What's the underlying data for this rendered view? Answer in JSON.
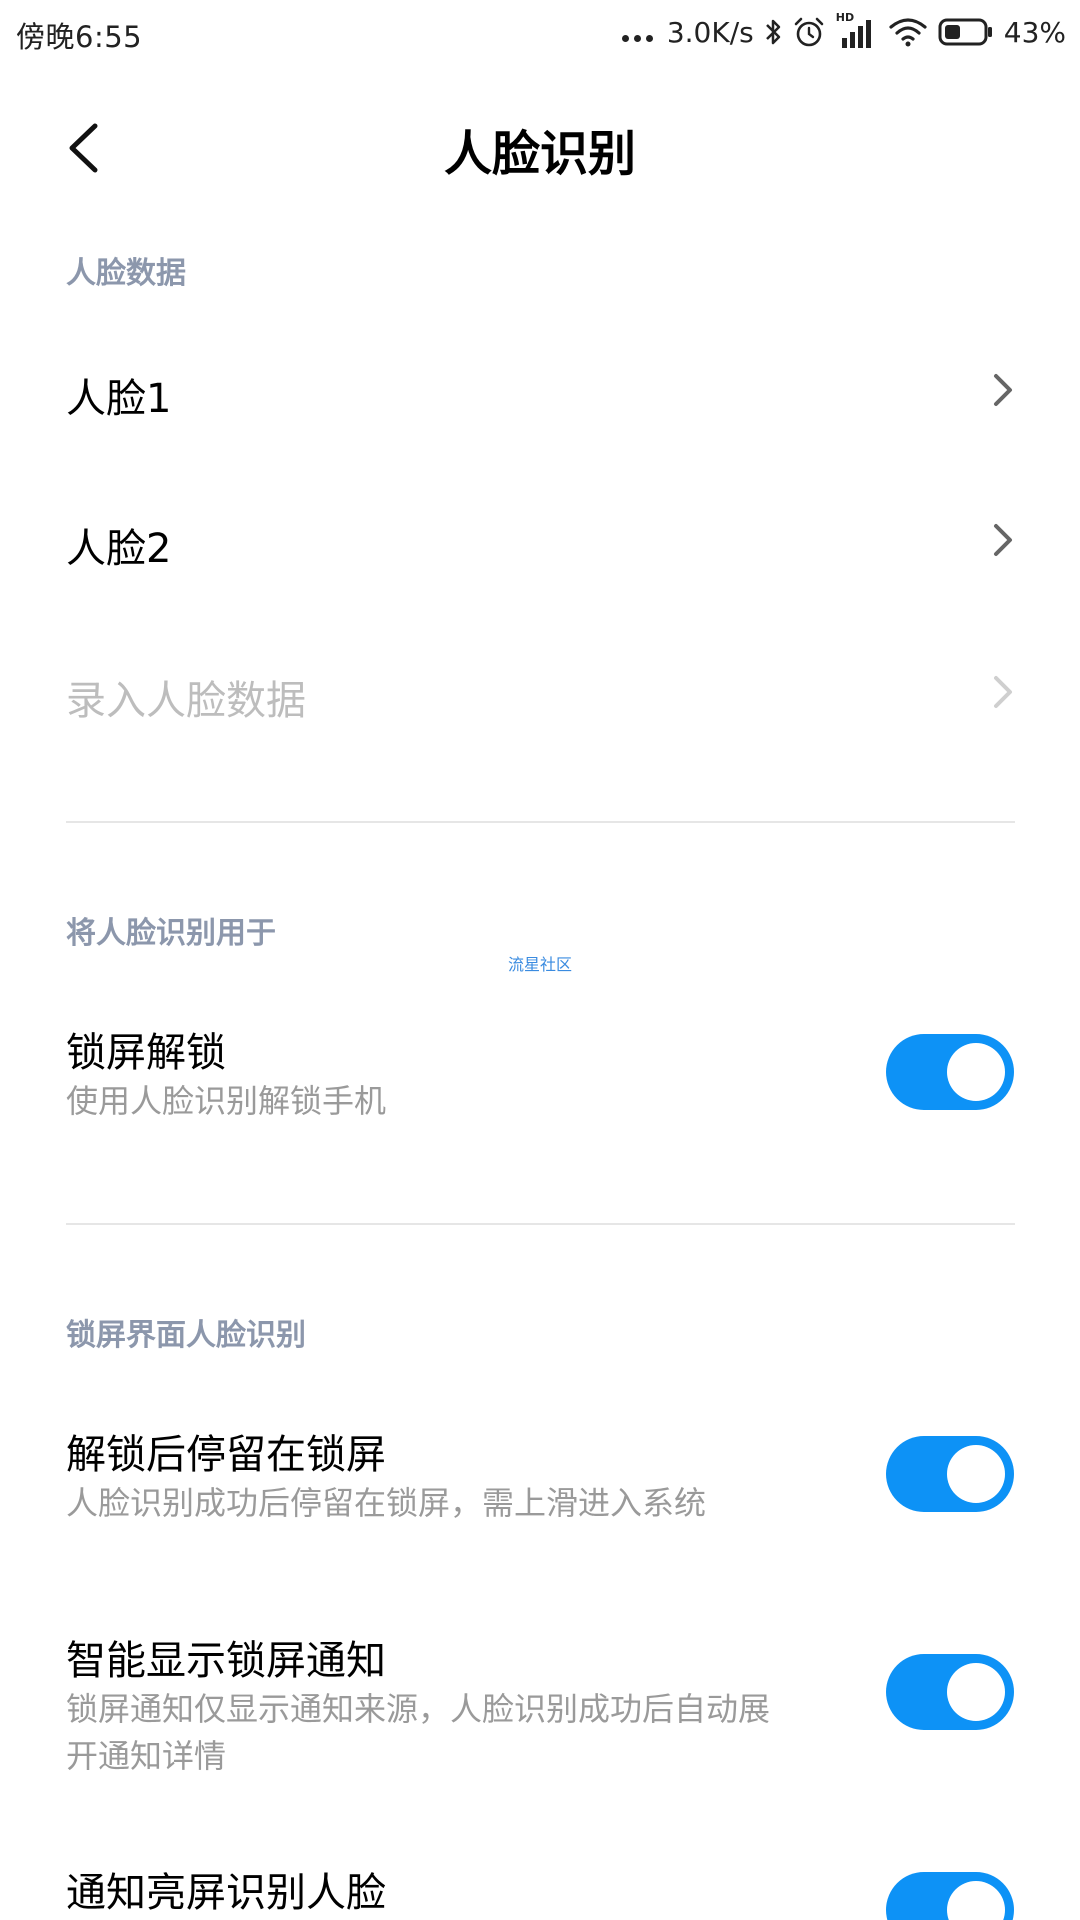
{
  "status_bar": {
    "time": "傍晚6:55",
    "network_speed": "3.0K/s",
    "hd_label": "HD",
    "battery_percent": "43%",
    "battery_level": 0.43,
    "icons": [
      "more-dots-icon",
      "bluetooth-icon",
      "alarm-icon",
      "hd-signal-icon",
      "wifi-icon",
      "battery-icon"
    ]
  },
  "header": {
    "title": "人脸识别",
    "back_icon": "chevron-left-icon"
  },
  "sections": {
    "face_data": {
      "header": "人脸数据",
      "items": [
        {
          "label": "人脸1",
          "enabled": true
        },
        {
          "label": "人脸2",
          "enabled": true
        },
        {
          "label": "录入人脸数据",
          "enabled": false
        }
      ]
    },
    "use_for": {
      "header": "将人脸识别用于",
      "items": [
        {
          "label": "锁屏解锁",
          "description": "使用人脸识别解锁手机",
          "on": true
        }
      ]
    },
    "lockscreen": {
      "header": "锁屏界面人脸识别",
      "items": [
        {
          "label": "解锁后停留在锁屏",
          "description": "人脸识别成功后停留在锁屏，需上滑进入系统",
          "on": true
        },
        {
          "label": "智能显示锁屏通知",
          "description_line1": "锁屏通知仅显示通知来源，人脸识别成功后自动展",
          "description_line2": "开通知详情",
          "on": true
        },
        {
          "label": "通知亮屏识别人脸",
          "on": true
        }
      ]
    }
  },
  "watermark": "流星社区",
  "colors": {
    "accent": "#0d92f6",
    "section_header": "#8c97ac",
    "subtitle": "#9a9a9a",
    "disabled": "#bdbdbd"
  }
}
